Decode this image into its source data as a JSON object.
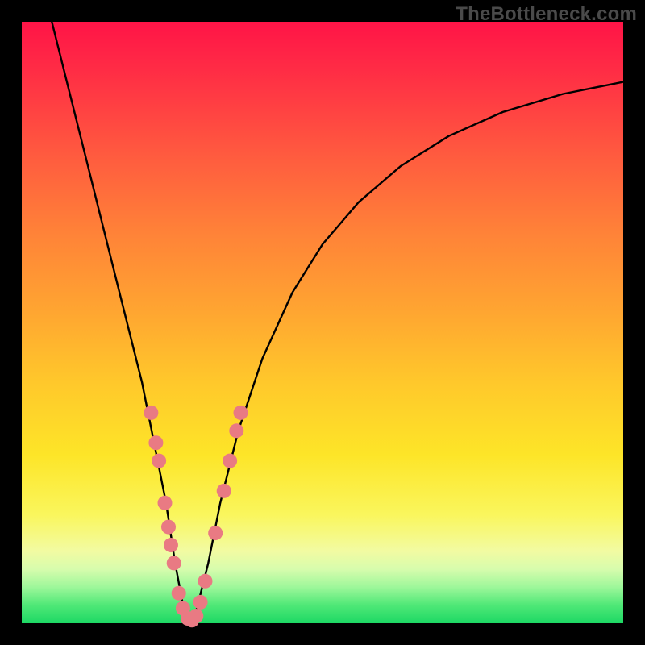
{
  "watermark": "TheBottleneck.com",
  "chart_data": {
    "type": "line",
    "title": "",
    "xlabel": "",
    "ylabel": "",
    "xlim": [
      0,
      100
    ],
    "ylim": [
      0,
      100
    ],
    "series": [
      {
        "name": "bottleneck-curve",
        "x": [
          5,
          8,
          11,
          14,
          17,
          20,
          22,
          24,
          25.5,
          27,
          28,
          29,
          31,
          33,
          36,
          40,
          45,
          50,
          56,
          63,
          71,
          80,
          90,
          100
        ],
        "y": [
          100,
          88,
          76,
          64,
          52,
          40,
          30,
          20,
          10,
          2,
          0,
          2,
          10,
          20,
          32,
          44,
          55,
          63,
          70,
          76,
          81,
          85,
          88,
          90
        ]
      }
    ],
    "markers": {
      "name": "highlighted-points",
      "color": "#e97a83",
      "points": [
        {
          "x": 21.5,
          "y": 35
        },
        {
          "x": 22.3,
          "y": 30
        },
        {
          "x": 22.8,
          "y": 27
        },
        {
          "x": 23.8,
          "y": 20
        },
        {
          "x": 24.4,
          "y": 16
        },
        {
          "x": 24.8,
          "y": 13
        },
        {
          "x": 25.3,
          "y": 10
        },
        {
          "x": 26.1,
          "y": 5
        },
        {
          "x": 26.8,
          "y": 2.5
        },
        {
          "x": 27.6,
          "y": 0.8
        },
        {
          "x": 28.3,
          "y": 0.5
        },
        {
          "x": 29.0,
          "y": 1.2
        },
        {
          "x": 29.7,
          "y": 3.5
        },
        {
          "x": 30.5,
          "y": 7
        },
        {
          "x": 32.2,
          "y": 15
        },
        {
          "x": 33.6,
          "y": 22
        },
        {
          "x": 34.6,
          "y": 27
        },
        {
          "x": 35.7,
          "y": 32
        },
        {
          "x": 36.4,
          "y": 35
        }
      ]
    }
  }
}
